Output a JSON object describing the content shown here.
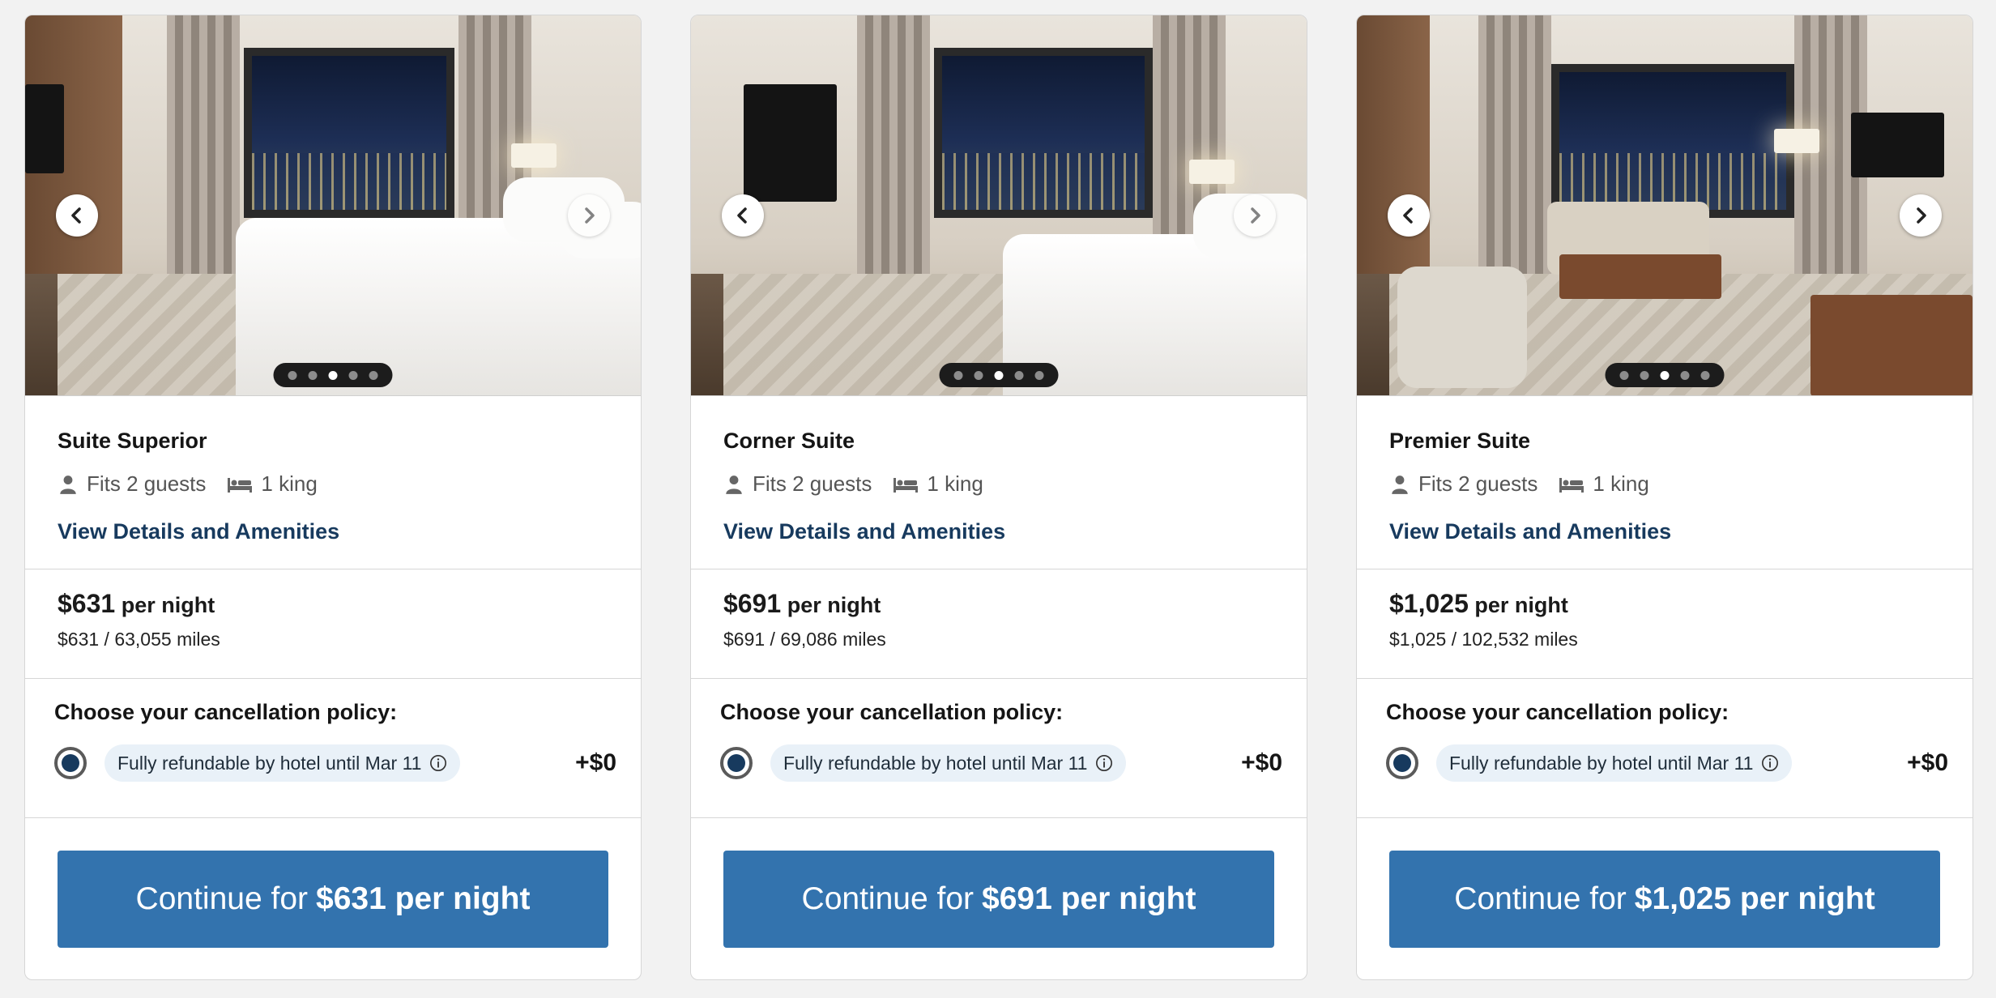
{
  "rooms": [
    {
      "name": "Suite Superior",
      "guests": "Fits 2 guests",
      "bed": "1 king",
      "details_link": "View Details and Amenities",
      "price_amount": "$631",
      "price_unit": "per night",
      "price_alt": "$631 / 63,055 miles",
      "cancellation_title": "Choose your cancellation policy:",
      "policy_label": "Fully refundable by hotel until Mar 11",
      "policy_addon": "+$0",
      "policy_selected": true,
      "cta_prefix": "Continue for",
      "cta_price": "$631 per night",
      "carousel": {
        "total": 5,
        "active_index": 2
      }
    },
    {
      "name": "Corner Suite",
      "guests": "Fits 2 guests",
      "bed": "1 king",
      "details_link": "View Details and Amenities",
      "price_amount": "$691",
      "price_unit": "per night",
      "price_alt": "$691 / 69,086 miles",
      "cancellation_title": "Choose your cancellation policy:",
      "policy_label": "Fully refundable by hotel until Mar 11",
      "policy_addon": "+$0",
      "policy_selected": true,
      "cta_prefix": "Continue for",
      "cta_price": "$691 per night",
      "carousel": {
        "total": 5,
        "active_index": 2
      }
    },
    {
      "name": "Premier Suite",
      "guests": "Fits 2 guests",
      "bed": "1 king",
      "details_link": "View Details and Amenities",
      "price_amount": "$1,025",
      "price_unit": "per night",
      "price_alt": "$1,025 / 102,532 miles",
      "cancellation_title": "Choose your cancellation policy:",
      "policy_label": "Fully refundable by hotel until Mar 11",
      "policy_addon": "+$0",
      "policy_selected": true,
      "cta_prefix": "Continue for",
      "cta_price": "$1,025 per night",
      "carousel": {
        "total": 5,
        "active_index": 2
      }
    }
  ],
  "icons": {
    "guests": "person-icon",
    "bed": "bed-icon",
    "info": "info-icon",
    "prev": "chevron-left-icon",
    "next": "chevron-right-icon"
  },
  "colors": {
    "cta_background": "#3373ae",
    "link": "#173a5e",
    "policy_pill": "#e9f1f8",
    "radio_selected": "#173a5e",
    "page_background": "#f2f2f2"
  }
}
